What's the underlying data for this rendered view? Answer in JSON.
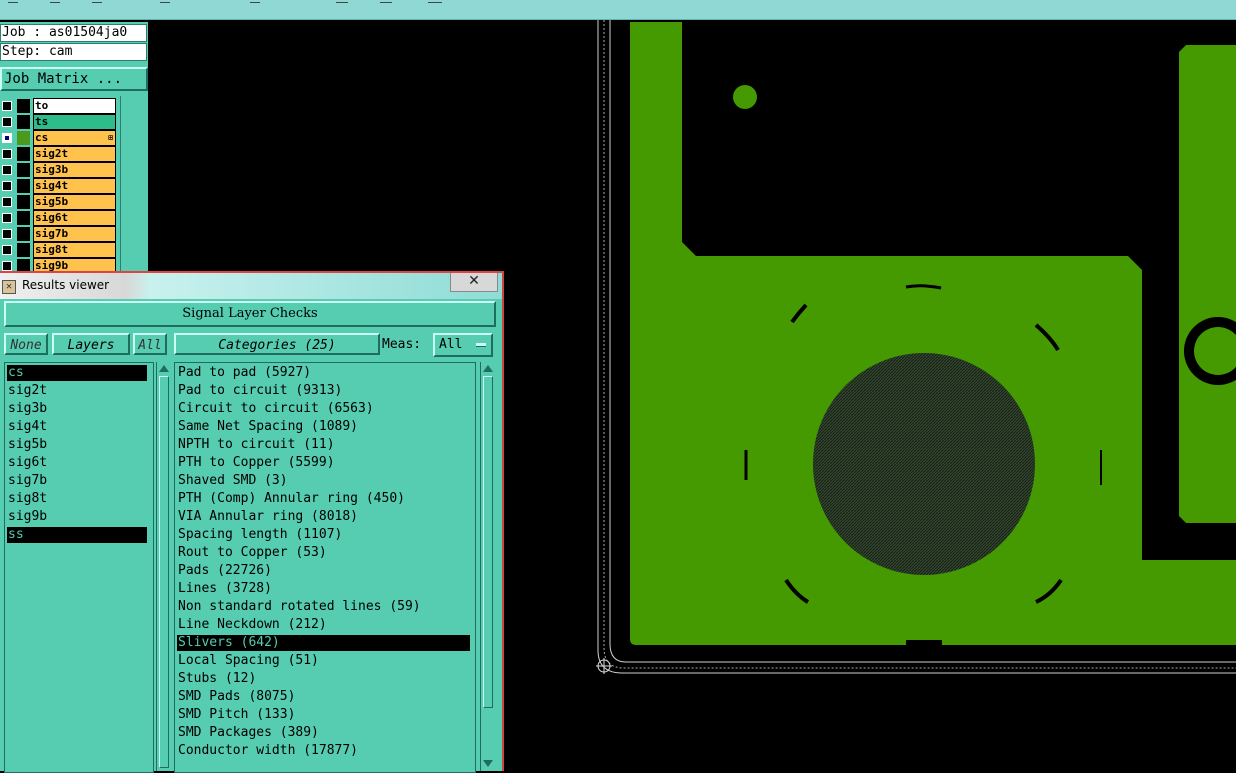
{
  "job_panel": {
    "job": "Job : as01504ja0",
    "step": "Step: cam",
    "job_matrix_button": "Job Matrix ...",
    "layers": [
      {
        "name": "to",
        "color": "#ffffff",
        "checked": false,
        "swatch": "#000000"
      },
      {
        "name": "ts",
        "color": "#2ebd8a",
        "checked": false,
        "swatch": "#000000"
      },
      {
        "name": "cs",
        "color": "#ffc24d",
        "checked": true,
        "swatch": "#4b9a1e",
        "mark": "⊞"
      },
      {
        "name": "sig2t",
        "color": "#ffc24d",
        "checked": false,
        "swatch": "#000000"
      },
      {
        "name": "sig3b",
        "color": "#ffc24d",
        "checked": false,
        "swatch": "#000000"
      },
      {
        "name": "sig4t",
        "color": "#ffc24d",
        "checked": false,
        "swatch": "#000000"
      },
      {
        "name": "sig5b",
        "color": "#ffc24d",
        "checked": false,
        "swatch": "#000000"
      },
      {
        "name": "sig6t",
        "color": "#ffc24d",
        "checked": false,
        "swatch": "#000000"
      },
      {
        "name": "sig7b",
        "color": "#ffc24d",
        "checked": false,
        "swatch": "#000000"
      },
      {
        "name": "sig8t",
        "color": "#ffc24d",
        "checked": false,
        "swatch": "#000000"
      },
      {
        "name": "sig9b",
        "color": "#ffc24d",
        "checked": false,
        "swatch": "#000000"
      }
    ]
  },
  "results_viewer": {
    "title": "Results viewer",
    "close": "✕",
    "header": "Signal Layer Checks",
    "none_button": "None",
    "layers_button": "Layers",
    "all_button": "All",
    "categories_button": "Categories (25)",
    "meas_label": "Meas:",
    "meas_value": "All",
    "layer_items": [
      {
        "label": "cs",
        "selected": true
      },
      {
        "label": "sig2t",
        "selected": false
      },
      {
        "label": "sig3b",
        "selected": false
      },
      {
        "label": "sig4t",
        "selected": false
      },
      {
        "label": "sig5b",
        "selected": false
      },
      {
        "label": "sig6t",
        "selected": false
      },
      {
        "label": "sig7b",
        "selected": false
      },
      {
        "label": "sig8t",
        "selected": false
      },
      {
        "label": "sig9b",
        "selected": false
      },
      {
        "label": "ss",
        "selected": true
      }
    ],
    "categories": [
      {
        "label": "Pad to pad (5927)",
        "selected": false
      },
      {
        "label": "Pad to circuit (9313)",
        "selected": false
      },
      {
        "label": "Circuit to circuit (6563)",
        "selected": false
      },
      {
        "label": "Same Net Spacing (1089)",
        "selected": false
      },
      {
        "label": "NPTH to circuit (11)",
        "selected": false
      },
      {
        "label": "PTH to Copper (5599)",
        "selected": false
      },
      {
        "label": "Shaved SMD (3)",
        "selected": false
      },
      {
        "label": "PTH (Comp) Annular ring (450)",
        "selected": false
      },
      {
        "label": "VIA Annular ring (8018)",
        "selected": false
      },
      {
        "label": "Spacing length (1107)",
        "selected": false
      },
      {
        "label": "Rout to Copper (53)",
        "selected": false
      },
      {
        "label": "Pads (22726)",
        "selected": false
      },
      {
        "label": "Lines (3728)",
        "selected": false
      },
      {
        "label": "Non standard rotated lines (59)",
        "selected": false
      },
      {
        "label": "Line Neckdown (212)",
        "selected": false
      },
      {
        "label": "Slivers (642)",
        "selected": true
      },
      {
        "label": "Local Spacing (51)",
        "selected": false
      },
      {
        "label": "Stubs (12)",
        "selected": false
      },
      {
        "label": "SMD Pads (8075)",
        "selected": false
      },
      {
        "label": "SMD Pitch (133)",
        "selected": false
      },
      {
        "label": "SMD Packages (389)",
        "selected": false
      },
      {
        "label": "Conductor width (17877)",
        "selected": false
      }
    ]
  },
  "board": {
    "copper_color": "#449a00",
    "outline_color": "#d0d0d0"
  }
}
